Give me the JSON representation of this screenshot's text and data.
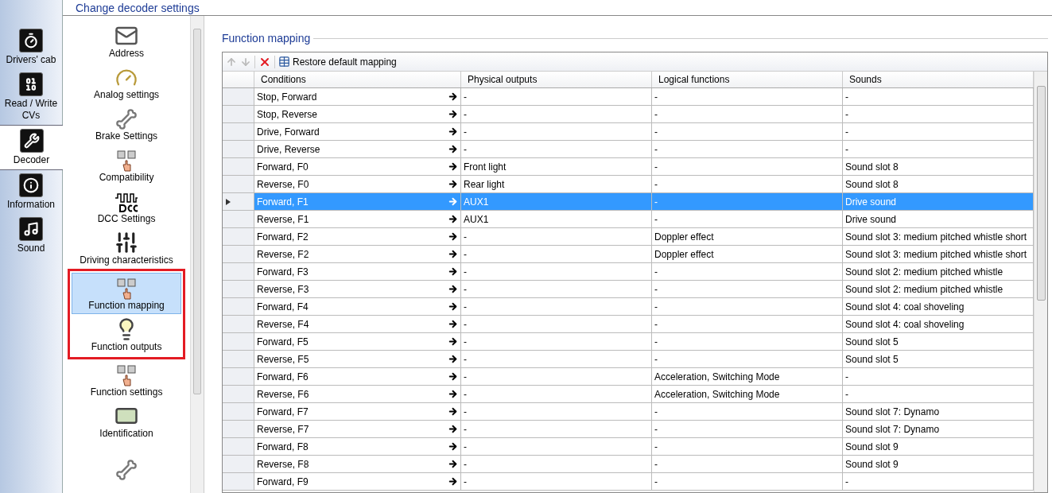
{
  "header": {
    "title": "Change decoder settings"
  },
  "nav": [
    {
      "label": "Drivers' cab",
      "selected": false
    },
    {
      "label": "Read / Write CVs",
      "selected": false
    },
    {
      "label": "Decoder",
      "selected": true
    },
    {
      "label": "Information",
      "selected": false
    },
    {
      "label": "Sound",
      "selected": false
    }
  ],
  "categories": [
    {
      "label": "Address",
      "selected": false,
      "highlighted": false
    },
    {
      "label": "Analog settings",
      "selected": false,
      "highlighted": false
    },
    {
      "label": "Brake Settings",
      "selected": false,
      "highlighted": false
    },
    {
      "label": "Compatibility",
      "selected": false,
      "highlighted": false
    },
    {
      "label": "DCC Settings",
      "selected": false,
      "highlighted": false
    },
    {
      "label": "Driving characteristics",
      "selected": false,
      "highlighted": false
    },
    {
      "label": "Function mapping",
      "selected": true,
      "highlighted": true
    },
    {
      "label": "Function outputs",
      "selected": false,
      "highlighted": true
    },
    {
      "label": "Function settings",
      "selected": false,
      "highlighted": false
    },
    {
      "label": "Identification",
      "selected": false,
      "highlighted": false
    },
    {
      "selected": false,
      "highlighted": false
    }
  ],
  "section": {
    "title": "Function mapping"
  },
  "toolbar": {
    "move_up_disabled": true,
    "move_down_disabled": true,
    "restore_label": "Restore default mapping"
  },
  "table": {
    "columns": [
      "Conditions",
      "Physical outputs",
      "Logical functions",
      "Sounds"
    ],
    "rows": [
      {
        "selected": false,
        "cells": [
          "Stop, Forward",
          "-",
          "-",
          "-"
        ]
      },
      {
        "selected": false,
        "cells": [
          "Stop, Reverse",
          "-",
          "-",
          "-"
        ]
      },
      {
        "selected": false,
        "cells": [
          "Drive, Forward",
          "-",
          "-",
          "-"
        ]
      },
      {
        "selected": false,
        "cells": [
          "Drive, Reverse",
          "-",
          "-",
          "-"
        ]
      },
      {
        "selected": false,
        "cells": [
          "Forward, F0",
          "Front light",
          "-",
          "Sound slot 8"
        ]
      },
      {
        "selected": false,
        "cells": [
          "Reverse, F0",
          "Rear light",
          "-",
          "Sound slot 8"
        ]
      },
      {
        "selected": true,
        "cells": [
          "Forward, F1",
          "AUX1",
          "-",
          "Drive sound"
        ]
      },
      {
        "selected": false,
        "cells": [
          "Reverse, F1",
          "AUX1",
          "-",
          "Drive sound"
        ]
      },
      {
        "selected": false,
        "cells": [
          "Forward, F2",
          "-",
          "Doppler effect",
          "Sound slot 3: medium pitched whistle short"
        ]
      },
      {
        "selected": false,
        "cells": [
          "Reverse, F2",
          "-",
          "Doppler effect",
          "Sound slot 3: medium pitched whistle short"
        ]
      },
      {
        "selected": false,
        "cells": [
          "Forward, F3",
          "-",
          "-",
          "Sound slot 2: medium pitched whistle"
        ]
      },
      {
        "selected": false,
        "cells": [
          "Reverse, F3",
          "-",
          "-",
          "Sound slot 2: medium pitched whistle"
        ]
      },
      {
        "selected": false,
        "cells": [
          "Forward, F4",
          "-",
          "-",
          "Sound slot 4: coal shoveling"
        ]
      },
      {
        "selected": false,
        "cells": [
          "Reverse, F4",
          "-",
          "-",
          "Sound slot 4: coal shoveling"
        ]
      },
      {
        "selected": false,
        "cells": [
          "Forward, F5",
          "-",
          "-",
          "Sound slot 5"
        ]
      },
      {
        "selected": false,
        "cells": [
          "Reverse, F5",
          "-",
          "-",
          "Sound slot 5"
        ]
      },
      {
        "selected": false,
        "cells": [
          "Forward, F6",
          "-",
          "Acceleration, Switching Mode",
          "-"
        ]
      },
      {
        "selected": false,
        "cells": [
          "Reverse, F6",
          "-",
          "Acceleration, Switching Mode",
          "-"
        ]
      },
      {
        "selected": false,
        "cells": [
          "Forward, F7",
          "-",
          "-",
          "Sound slot 7: Dynamo"
        ]
      },
      {
        "selected": false,
        "cells": [
          "Reverse, F7",
          "-",
          "-",
          "Sound slot 7: Dynamo"
        ]
      },
      {
        "selected": false,
        "cells": [
          "Forward, F8",
          "-",
          "-",
          "Sound slot 9"
        ]
      },
      {
        "selected": false,
        "cells": [
          "Reverse, F8",
          "-",
          "-",
          "Sound slot 9"
        ]
      },
      {
        "selected": false,
        "cells": [
          "Forward, F9",
          "-",
          "-",
          "-"
        ]
      }
    ]
  }
}
